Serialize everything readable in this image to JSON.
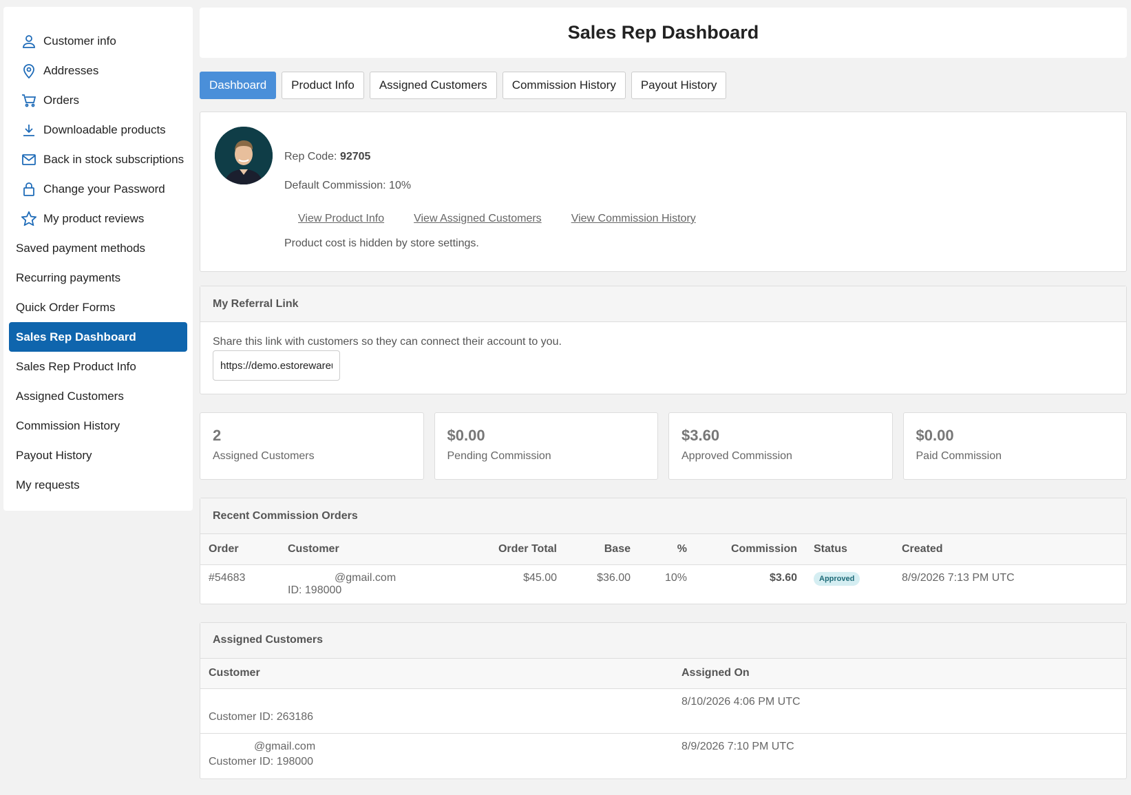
{
  "sidebar": {
    "items": [
      {
        "label": "Customer info",
        "icon": "user-icon"
      },
      {
        "label": "Addresses",
        "icon": "map-pin-icon"
      },
      {
        "label": "Orders",
        "icon": "cart-icon"
      },
      {
        "label": "Downloadable products",
        "icon": "download-icon"
      },
      {
        "label": "Back in stock subscriptions",
        "icon": "mail-icon"
      },
      {
        "label": "Change your Password",
        "icon": "lock-icon"
      },
      {
        "label": "My product reviews",
        "icon": "star-icon"
      },
      {
        "label": "Saved payment methods"
      },
      {
        "label": "Recurring payments"
      },
      {
        "label": "Quick Order Forms"
      },
      {
        "label": "Sales Rep Dashboard"
      },
      {
        "label": "Sales Rep Product Info"
      },
      {
        "label": "Assigned Customers"
      },
      {
        "label": "Commission History"
      },
      {
        "label": "Payout History"
      },
      {
        "label": "My requests"
      }
    ],
    "active": "Sales Rep Dashboard"
  },
  "page": {
    "title": "Sales Rep Dashboard"
  },
  "tabs": [
    "Dashboard",
    "Product Info",
    "Assigned Customers",
    "Commission History",
    "Payout History"
  ],
  "profile": {
    "rep_code_label": "Rep Code:",
    "rep_code": "92705",
    "default_commission": "Default Commission: 10%",
    "links": [
      "View Product Info",
      "View Assigned Customers",
      "View Commission History"
    ],
    "note": "Product cost is hidden by store settings."
  },
  "referral": {
    "heading": "My Referral Link",
    "description": "Share this link with customers so they can connect their account to you.",
    "link_value": "https://demo.estorewareusa"
  },
  "stats": [
    {
      "value": "2",
      "label": "Assigned Customers"
    },
    {
      "value": "$0.00",
      "label": "Pending Commission"
    },
    {
      "value": "$3.60",
      "label": "Approved Commission"
    },
    {
      "value": "$0.00",
      "label": "Paid Commission"
    }
  ],
  "recent_orders": {
    "heading": "Recent Commission Orders",
    "columns": [
      "Order",
      "Customer",
      "Order Total",
      "Base",
      "%",
      "Commission",
      "Status",
      "Created"
    ],
    "rows": [
      {
        "order": "#54683",
        "customer_email": "@gmail.com",
        "customer_id": "ID: 198000",
        "order_total": "$45.00",
        "base": "$36.00",
        "percent": "10%",
        "commission": "$3.60",
        "status": "Approved",
        "created": "8/9/2026 7:13 PM UTC"
      }
    ]
  },
  "assigned_customers": {
    "heading": "Assigned Customers",
    "columns": [
      "Customer",
      "Assigned On"
    ],
    "rows": [
      {
        "email": "",
        "customer_id": "Customer ID: 263186",
        "assigned_on": "8/10/2026 4:06 PM UTC"
      },
      {
        "email": "@gmail.com",
        "customer_id": "Customer ID: 198000",
        "assigned_on": "8/9/2026 7:10 PM UTC"
      }
    ]
  }
}
